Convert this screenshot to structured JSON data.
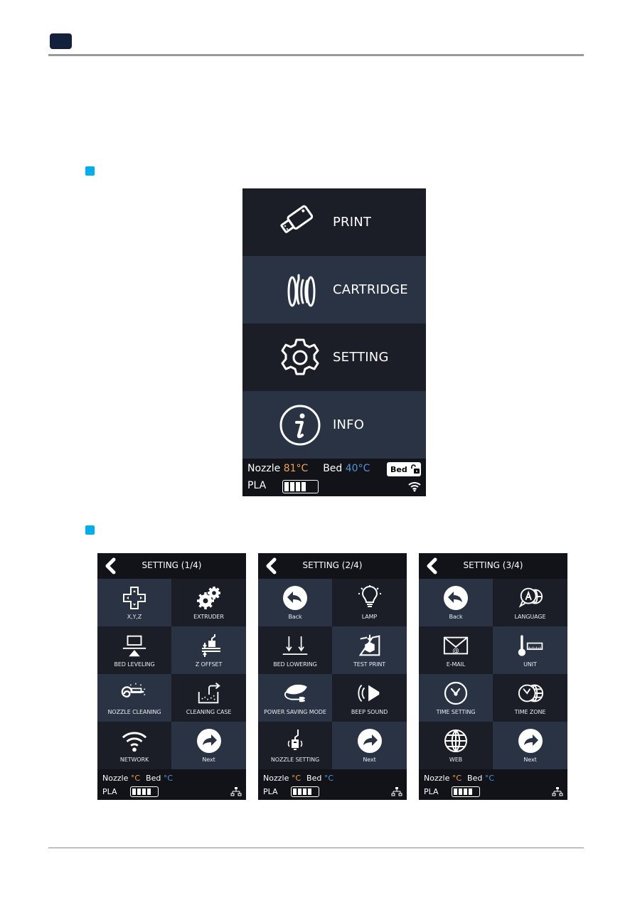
{
  "colors": {
    "chapter_badge": "#14213d",
    "bullet": "#00aeef",
    "screen_bg": "#111319",
    "tile_dark": "#1b1e27",
    "tile_light": "#2a3344",
    "nozzle_temp": "#f0a24a",
    "bed_temp": "#4e95d9"
  },
  "main_menu": {
    "items": [
      {
        "label": "PRINT",
        "icon": "usb-drive-icon"
      },
      {
        "label": "CARTRIDGE",
        "icon": "filament-spool-icon"
      },
      {
        "label": "SETTING",
        "icon": "gear-icon"
      },
      {
        "label": "INFO",
        "icon": "info-icon"
      }
    ],
    "status": {
      "nozzle_label": "Nozzle",
      "nozzle_temp": "81°C",
      "bed_label": "Bed",
      "bed_temp": "40°C",
      "bed_button_label": "Bed",
      "bed_lock_icon": "unlock-icon",
      "material": "PLA",
      "cartridge_level_cells": 4,
      "connection_icon": "wifi-icon"
    }
  },
  "settings_screens": [
    {
      "title": "SETTING (1/4)",
      "tiles": [
        {
          "label": "X,Y,Z",
          "icon": "dpad-icon"
        },
        {
          "label": "EXTRUDER",
          "icon": "gears-icon"
        },
        {
          "label": "BED LEVELING",
          "icon": "bed-leveling-icon"
        },
        {
          "label": "Z OFFSET",
          "icon": "z-offset-icon"
        },
        {
          "label": "NOZZLE CLEANING",
          "icon": "nozzle-cleaning-icon"
        },
        {
          "label": "CLEANING CASE",
          "icon": "cleaning-case-icon"
        },
        {
          "label": "NETWORK",
          "icon": "wifi-icon"
        },
        {
          "label": "Next",
          "icon": "next-arrow-icon"
        }
      ],
      "status": {
        "nozzle_label": "Nozzle",
        "nozzle_temp": "°C",
        "bed_label": "Bed",
        "bed_temp": "°C",
        "material": "PLA",
        "cartridge_level_cells": 4,
        "connection_icon": "lan-icon"
      }
    },
    {
      "title": "SETTING (2/4)",
      "tiles": [
        {
          "label": "Back",
          "icon": "back-arrow-icon"
        },
        {
          "label": "LAMP",
          "icon": "lightbulb-icon"
        },
        {
          "label": "BED LOWERING",
          "icon": "bed-lowering-icon"
        },
        {
          "label": "TEST PRINT",
          "icon": "test-print-icon"
        },
        {
          "label": "POWER SAVING MODE",
          "icon": "leaf-plug-icon"
        },
        {
          "label": "BEEP SOUND",
          "icon": "speaker-icon"
        },
        {
          "label": "NOZZLE SETTING",
          "icon": "nozzle-icon"
        },
        {
          "label": "Next",
          "icon": "next-arrow-icon"
        }
      ],
      "status": {
        "nozzle_label": "Nozzle",
        "nozzle_temp": "°C",
        "bed_label": "Bed",
        "bed_temp": "°C",
        "material": "PLA",
        "cartridge_level_cells": 4,
        "connection_icon": "lan-icon"
      }
    },
    {
      "title": "SETTING (3/4)",
      "tiles": [
        {
          "label": "Back",
          "icon": "back-arrow-icon"
        },
        {
          "label": "LANGUAGE",
          "icon": "language-icon"
        },
        {
          "label": "E-MAIL",
          "icon": "email-icon"
        },
        {
          "label": "UNIT",
          "icon": "thermometer-ruler-icon"
        },
        {
          "label": "TIME SETTING",
          "icon": "clock-icon"
        },
        {
          "label": "TIME ZONE",
          "icon": "clock-globe-icon"
        },
        {
          "label": "WEB",
          "icon": "globe-icon"
        },
        {
          "label": "Next",
          "icon": "next-arrow-icon"
        }
      ],
      "status": {
        "nozzle_label": "Nozzle",
        "nozzle_temp": "°C",
        "bed_label": "Bed",
        "bed_temp": "°C",
        "material": "PLA",
        "cartridge_level_cells": 4,
        "connection_icon": "lan-icon"
      }
    }
  ]
}
